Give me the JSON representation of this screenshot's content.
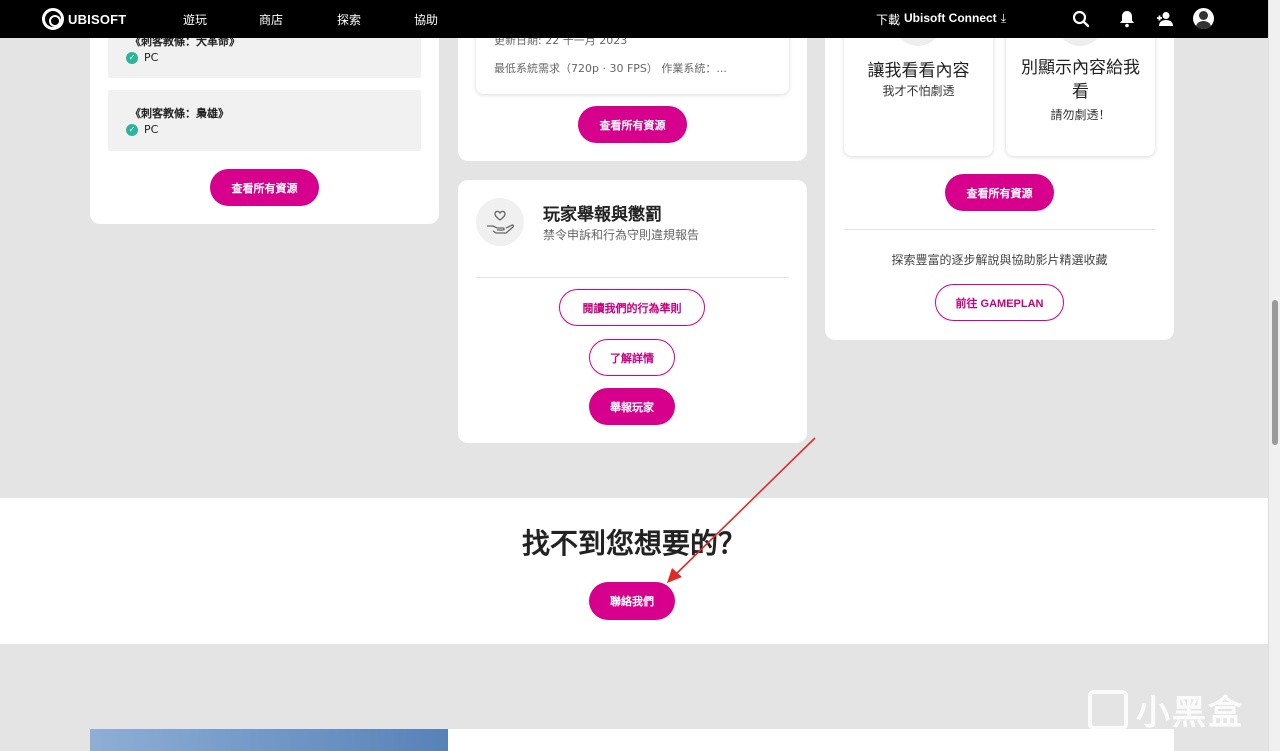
{
  "nav": {
    "brand": "UBISOFT",
    "links": [
      "遊玩",
      "商店",
      "探索",
      "協助"
    ],
    "download_prefix": "下載",
    "download_app": "Ubisoft Connect",
    "download_icon": "⤓"
  },
  "left_card": {
    "games": [
      {
        "title": "《刺客教條：大革命》",
        "platform": "PC"
      },
      {
        "title": "《刺客教條：梟雄》",
        "platform": "PC"
      }
    ],
    "button": "查看所有資源"
  },
  "mid_card": {
    "update_text": "更新日期: 22 十一月 2023",
    "requirements_text": "最低系統需求（720p · 30 FPS） 作業系統：...",
    "button": "查看所有資源"
  },
  "report_card": {
    "title": "玩家舉報與懲罰",
    "subtitle": "禁令申訴和行為守則違規報告",
    "buttons": {
      "code_of_conduct": "閱讀我們的行為準則",
      "learn_more": "了解詳情",
      "report_player": "舉報玩家"
    }
  },
  "spoiler_card": {
    "option_show": {
      "title": "讓我看看內容",
      "subtitle": "我才不怕劇透"
    },
    "option_hide": {
      "title": "別顯示內容給我看",
      "subtitle": "請勿劇透！"
    },
    "button": "查看所有資源",
    "gameplan_text": "探索豐富的逐步解說與協助影片精選收藏",
    "gameplan_button": "前往 GAMEPLAN"
  },
  "contact": {
    "heading": "找不到您想要的？",
    "button": "聯絡我們"
  },
  "watermark": "小黑盒",
  "colors": {
    "accent": "#d6008c",
    "check": "#2cb59a",
    "background": "#e4e4e4",
    "nav": "#000000"
  }
}
